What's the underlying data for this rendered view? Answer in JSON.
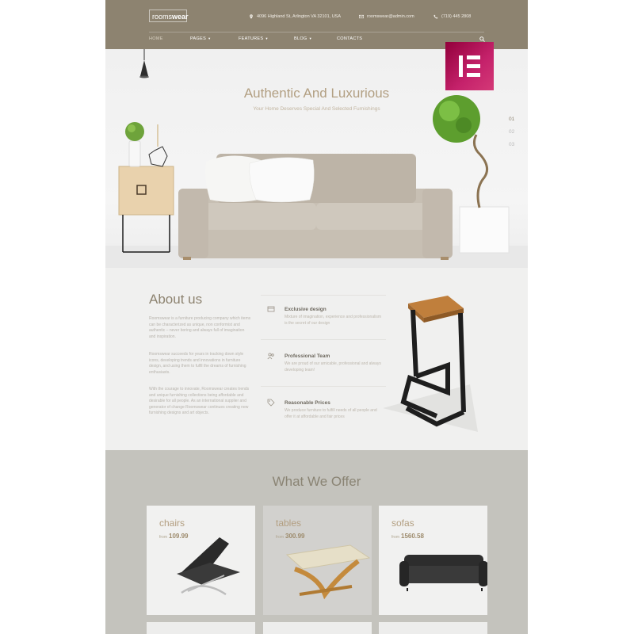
{
  "header": {
    "logo": {
      "light": "rooms",
      "bold": "wear"
    },
    "address": "4096 Highland St, Arlington VA 32101, USA",
    "email": "roomswear@admin.com",
    "phone": "(719) 445 2808",
    "nav": [
      "HOME",
      "PAGES",
      "FEATURES",
      "BLOG",
      "CONTACTS"
    ]
  },
  "hero": {
    "title": "Authentic And Luxurious",
    "subtitle": "Your Home Deserves Special And Selected Furnishings",
    "slides": [
      "01",
      "02",
      "03"
    ]
  },
  "about": {
    "title": "About us",
    "paragraphs": [
      "Roomswear is a furniture producing company which items can be characterized as unique, non conformist and authentic – never boring and always full of imagination and inspiration.",
      "Roomswear succeeds for years in tracking down style icons, developing trends and innovations in furniture design, and using them to fulfil the dreams of furnishing enthusiasts.",
      "With the courage to innovate, Roomswear creates trends and unique furnishing collections being affordable and desirable for all people. As an international supplier and generator of change Roomswear continues creating new furnishing designs and art objects."
    ],
    "features": [
      {
        "title": "Exclusive design",
        "text": "Mixture of imagination, experience and professionalism is the secret of our design"
      },
      {
        "title": "Professional Team",
        "text": "We are proud of our amicable, professional and always developing team!"
      },
      {
        "title": "Reasonable Prices",
        "text": "We produce furniture to fulfill needs of all people and offer it at affordable and fair prices"
      }
    ]
  },
  "offer": {
    "title": "What We Offer",
    "cards": [
      {
        "title": "chairs",
        "from": "from",
        "price": "109.99"
      },
      {
        "title": "tables",
        "from": "from",
        "price": "300.99"
      },
      {
        "title": "sofas",
        "from": "from",
        "price": "1560.58"
      }
    ]
  },
  "colors": {
    "header_bg": "#8d8370",
    "accent": "#b29f82",
    "about_bg": "#f0f0ef",
    "offer_bg": "#c4c3bd",
    "elementor": "#c5226b"
  },
  "icons": [
    "pin-icon",
    "mail-icon",
    "phone-icon",
    "search-icon",
    "elementor-logo",
    "design-icon",
    "team-icon",
    "price-tag-icon"
  ]
}
